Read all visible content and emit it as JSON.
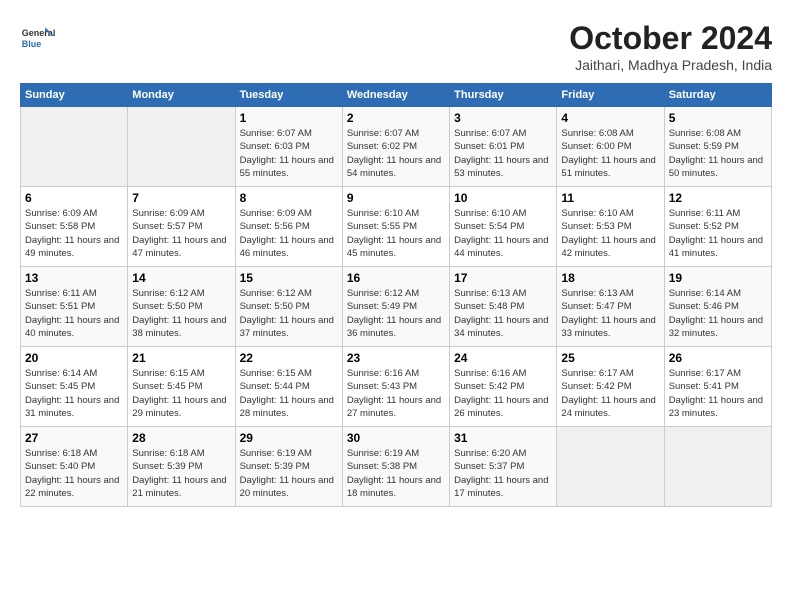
{
  "header": {
    "logo_line1": "General",
    "logo_line2": "Blue",
    "month": "October 2024",
    "location": "Jaithari, Madhya Pradesh, India"
  },
  "days_of_week": [
    "Sunday",
    "Monday",
    "Tuesday",
    "Wednesday",
    "Thursday",
    "Friday",
    "Saturday"
  ],
  "weeks": [
    [
      {
        "day": "",
        "empty": true
      },
      {
        "day": "",
        "empty": true
      },
      {
        "day": "1",
        "sunrise": "6:07 AM",
        "sunset": "6:03 PM",
        "daylight": "11 hours and 55 minutes."
      },
      {
        "day": "2",
        "sunrise": "6:07 AM",
        "sunset": "6:02 PM",
        "daylight": "11 hours and 54 minutes."
      },
      {
        "day": "3",
        "sunrise": "6:07 AM",
        "sunset": "6:01 PM",
        "daylight": "11 hours and 53 minutes."
      },
      {
        "day": "4",
        "sunrise": "6:08 AM",
        "sunset": "6:00 PM",
        "daylight": "11 hours and 51 minutes."
      },
      {
        "day": "5",
        "sunrise": "6:08 AM",
        "sunset": "5:59 PM",
        "daylight": "11 hours and 50 minutes."
      }
    ],
    [
      {
        "day": "6",
        "sunrise": "6:09 AM",
        "sunset": "5:58 PM",
        "daylight": "11 hours and 49 minutes."
      },
      {
        "day": "7",
        "sunrise": "6:09 AM",
        "sunset": "5:57 PM",
        "daylight": "11 hours and 47 minutes."
      },
      {
        "day": "8",
        "sunrise": "6:09 AM",
        "sunset": "5:56 PM",
        "daylight": "11 hours and 46 minutes."
      },
      {
        "day": "9",
        "sunrise": "6:10 AM",
        "sunset": "5:55 PM",
        "daylight": "11 hours and 45 minutes."
      },
      {
        "day": "10",
        "sunrise": "6:10 AM",
        "sunset": "5:54 PM",
        "daylight": "11 hours and 44 minutes."
      },
      {
        "day": "11",
        "sunrise": "6:10 AM",
        "sunset": "5:53 PM",
        "daylight": "11 hours and 42 minutes."
      },
      {
        "day": "12",
        "sunrise": "6:11 AM",
        "sunset": "5:52 PM",
        "daylight": "11 hours and 41 minutes."
      }
    ],
    [
      {
        "day": "13",
        "sunrise": "6:11 AM",
        "sunset": "5:51 PM",
        "daylight": "11 hours and 40 minutes."
      },
      {
        "day": "14",
        "sunrise": "6:12 AM",
        "sunset": "5:50 PM",
        "daylight": "11 hours and 38 minutes."
      },
      {
        "day": "15",
        "sunrise": "6:12 AM",
        "sunset": "5:50 PM",
        "daylight": "11 hours and 37 minutes."
      },
      {
        "day": "16",
        "sunrise": "6:12 AM",
        "sunset": "5:49 PM",
        "daylight": "11 hours and 36 minutes."
      },
      {
        "day": "17",
        "sunrise": "6:13 AM",
        "sunset": "5:48 PM",
        "daylight": "11 hours and 34 minutes."
      },
      {
        "day": "18",
        "sunrise": "6:13 AM",
        "sunset": "5:47 PM",
        "daylight": "11 hours and 33 minutes."
      },
      {
        "day": "19",
        "sunrise": "6:14 AM",
        "sunset": "5:46 PM",
        "daylight": "11 hours and 32 minutes."
      }
    ],
    [
      {
        "day": "20",
        "sunrise": "6:14 AM",
        "sunset": "5:45 PM",
        "daylight": "11 hours and 31 minutes."
      },
      {
        "day": "21",
        "sunrise": "6:15 AM",
        "sunset": "5:45 PM",
        "daylight": "11 hours and 29 minutes."
      },
      {
        "day": "22",
        "sunrise": "6:15 AM",
        "sunset": "5:44 PM",
        "daylight": "11 hours and 28 minutes."
      },
      {
        "day": "23",
        "sunrise": "6:16 AM",
        "sunset": "5:43 PM",
        "daylight": "11 hours and 27 minutes."
      },
      {
        "day": "24",
        "sunrise": "6:16 AM",
        "sunset": "5:42 PM",
        "daylight": "11 hours and 26 minutes."
      },
      {
        "day": "25",
        "sunrise": "6:17 AM",
        "sunset": "5:42 PM",
        "daylight": "11 hours and 24 minutes."
      },
      {
        "day": "26",
        "sunrise": "6:17 AM",
        "sunset": "5:41 PM",
        "daylight": "11 hours and 23 minutes."
      }
    ],
    [
      {
        "day": "27",
        "sunrise": "6:18 AM",
        "sunset": "5:40 PM",
        "daylight": "11 hours and 22 minutes."
      },
      {
        "day": "28",
        "sunrise": "6:18 AM",
        "sunset": "5:39 PM",
        "daylight": "11 hours and 21 minutes."
      },
      {
        "day": "29",
        "sunrise": "6:19 AM",
        "sunset": "5:39 PM",
        "daylight": "11 hours and 20 minutes."
      },
      {
        "day": "30",
        "sunrise": "6:19 AM",
        "sunset": "5:38 PM",
        "daylight": "11 hours and 18 minutes."
      },
      {
        "day": "31",
        "sunrise": "6:20 AM",
        "sunset": "5:37 PM",
        "daylight": "11 hours and 17 minutes."
      },
      {
        "day": "",
        "empty": true
      },
      {
        "day": "",
        "empty": true
      }
    ]
  ]
}
